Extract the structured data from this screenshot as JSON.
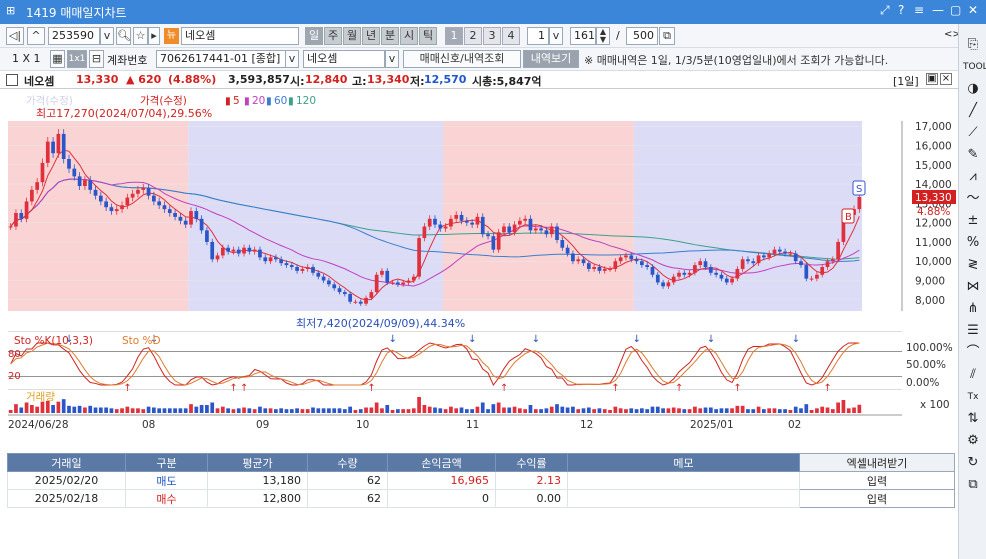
{
  "window": {
    "title": "1419 매매일지차트",
    "controls": [
      "⤢",
      "?",
      "≡",
      "—",
      "▢",
      "✕"
    ]
  },
  "toolbar1": {
    "code": "253590",
    "stock_tag": "뉴",
    "stock_name": "네오셈",
    "period_btns": [
      "일",
      "주",
      "월",
      "년",
      "분",
      "시",
      "틱"
    ],
    "period_selected": "일",
    "pages": [
      "1",
      "2",
      "3",
      "4"
    ],
    "page_selected": "1",
    "interval": "1",
    "count": "161",
    "slash": "/",
    "total": "500"
  },
  "toolbar2": {
    "layout1": "1 X 1",
    "layout_sel": "1x1",
    "account_label": "계좌번호",
    "account": "7062617441-01 [종합]",
    "stock2": "네오셈",
    "btn_signal": "매매신호/내역조회",
    "btn_history": "내역보기",
    "notice": "※ 매매내역은 1일, 1/3/5분(10영업일내)에서 조회가 가능합니다."
  },
  "info": {
    "name": "네오셈",
    "price": "13,330",
    "change": "▲ 620",
    "pct": "(4.88%)",
    "volume": "3,593,857",
    "open_l": "시:",
    "open": "12,840",
    "high_l": "고:",
    "high": "13,340",
    "low_l": "저:",
    "low": "12,570",
    "cap": "시총:5,847억",
    "page": "[1일]"
  },
  "main_legend": {
    "watermark": "가격(수정)",
    "price": "가격(수정)",
    "ma5": "5",
    "ma20": "20",
    "ma60": "60",
    "ma120": "120"
  },
  "annotations": {
    "high": "최고17,270(2024/07/04),29.56%",
    "low": "최저7,420(2024/09/09),44.34%",
    "price_tag": "13,330",
    "pct_tag": "4.88%",
    "s": "S",
    "b": "B"
  },
  "sto_legend": {
    "k": "Sto %K(10,3,3)",
    "d": "Sto %D"
  },
  "sto_axis": [
    "100.00%",
    "50.00%",
    "0.00%"
  ],
  "sto_left": [
    "80",
    "20"
  ],
  "vol_legend": "거래량",
  "vol_axis": "x 100",
  "x_labels": [
    "2024/06/28",
    "08",
    "09",
    "10",
    "11",
    "12",
    "2025/01",
    "02"
  ],
  "colors": {
    "up": "#e0303c",
    "down": "#2a56c8",
    "pink": "#fad4d4",
    "lavender": "#dcdcf6",
    "ma5": "#e0303c",
    "ma20": "#c040c0",
    "ma60": "#3b7dcf",
    "ma120": "#3ca08c"
  },
  "chart_data": {
    "type": "candlestick",
    "y_axis_ticks": [
      8000,
      9000,
      10000,
      11000,
      12000,
      13000,
      14000,
      15000,
      16000,
      17000
    ],
    "y_axis_labels": [
      "8,000",
      "9,000",
      "10,000",
      "11,000",
      "12,000",
      "13,000",
      "14,000",
      "15,000",
      "16,000",
      "17,000"
    ],
    "ylim": [
      7420,
      17270
    ],
    "last_close": 13330,
    "closes": [
      11800,
      12500,
      12200,
      13100,
      13700,
      14100,
      15100,
      16200,
      15600,
      16600,
      15300,
      14800,
      14400,
      13900,
      14200,
      13700,
      13400,
      13100,
      12800,
      12600,
      12700,
      12900,
      13300,
      13500,
      13700,
      13800,
      13400,
      13100,
      12900,
      12700,
      12500,
      12300,
      12100,
      11900,
      12600,
      12200,
      11600,
      11000,
      10100,
      10300,
      10700,
      10500,
      10600,
      10400,
      10700,
      10500,
      10600,
      10200,
      10000,
      10200,
      10100,
      9900,
      9800,
      9700,
      9500,
      9600,
      9700,
      9400,
      9200,
      9000,
      8800,
      8600,
      8400,
      8300,
      7900,
      7900,
      7800,
      8100,
      8400,
      9300,
      9500,
      8900,
      8900,
      8800,
      8900,
      9000,
      9200,
      11200,
      11800,
      12200,
      11900,
      11700,
      11800,
      12200,
      12400,
      12100,
      12000,
      11900,
      12300,
      11400,
      11300,
      10600,
      11500,
      11800,
      11500,
      11900,
      12100,
      12200,
      11600,
      11700,
      11600,
      11400,
      11800,
      11100,
      10700,
      10400,
      10000,
      10100,
      9900,
      9600,
      9700,
      9500,
      9600,
      9600,
      10000,
      10200,
      10300,
      10100,
      10000,
      9800,
      9700,
      9300,
      8900,
      8700,
      8900,
      9200,
      9400,
      9300,
      9400,
      9800,
      10000,
      9700,
      9400,
      9300,
      9100,
      8900,
      9100,
      9600,
      10100,
      10000,
      9900,
      10300,
      10200,
      10400,
      10600,
      10500,
      10400,
      10400,
      10000,
      9800,
      9100,
      9100,
      9300,
      9700,
      10000,
      10100,
      11000,
      12200,
      12400,
      12700,
      13330
    ],
    "periods": [
      {
        "shade": "pink",
        "from": 0,
        "to": 34
      },
      {
        "shade": "lavender",
        "from": 34,
        "to": 82
      },
      {
        "shade": "pink",
        "from": 82,
        "to": 118
      },
      {
        "shade": "lavender",
        "from": 118,
        "to": 165
      },
      {
        "shade": "pink",
        "from": 165,
        "to": 185
      },
      {
        "shade": "lavender",
        "from": 185,
        "to": 194
      },
      {
        "shade": "pink",
        "from": 194,
        "to": 206
      }
    ],
    "trades": [
      {
        "date": "2025/02/20",
        "type": "매도",
        "avg_price": "13,180",
        "qty": "62",
        "pnl": "16,965",
        "rate": "2.13",
        "memo": ""
      },
      {
        "date": "2025/02/18",
        "type": "매수",
        "avg_price": "12,800",
        "qty": "62",
        "pnl": "0",
        "rate": "0.00",
        "memo": ""
      }
    ]
  },
  "table": {
    "headers": [
      "거래일",
      "구분",
      "평균가",
      "수량",
      "손익금액",
      "수익률",
      "메모"
    ],
    "excel_btn": "엑셀내려받기",
    "input_btn": "입력"
  }
}
